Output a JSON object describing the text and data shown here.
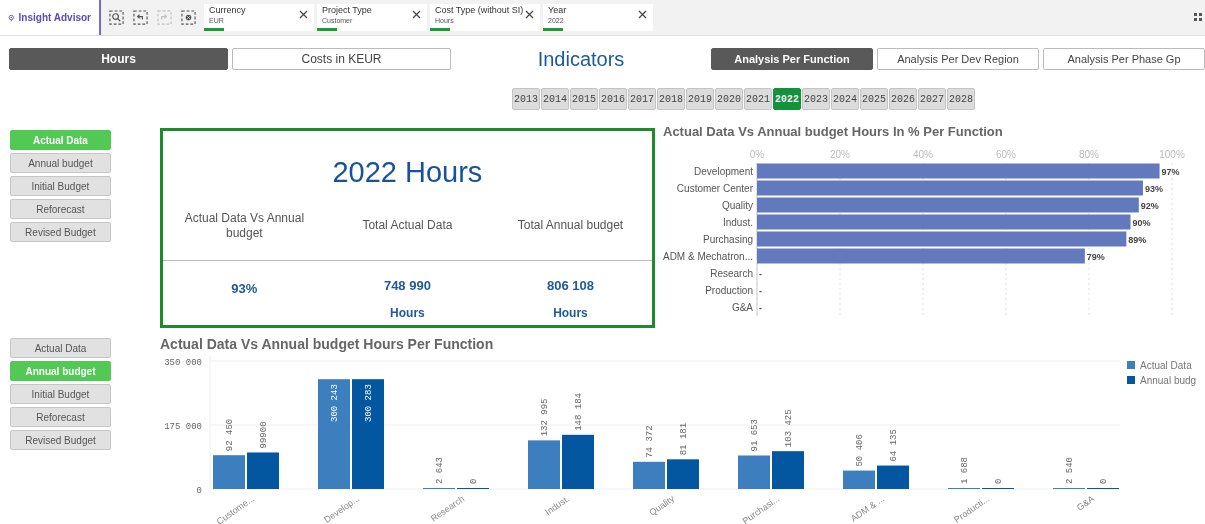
{
  "toolbar": {
    "advisor_label": "Insight Advisor",
    "tools": [
      {
        "kind": "search",
        "disabled": false
      },
      {
        "kind": "back",
        "disabled": false
      },
      {
        "kind": "forward",
        "disabled": true
      },
      {
        "kind": "clear",
        "disabled": false
      }
    ],
    "filters": [
      {
        "label": "Currency",
        "value": "EUR"
      },
      {
        "label": "Project Type",
        "value": "Customer"
      },
      {
        "label": "Cost Type (without SI)",
        "value": "Hours"
      },
      {
        "label": "Year",
        "value": "2022"
      }
    ]
  },
  "measure_tabs": [
    {
      "label": "Hours",
      "selected": true
    },
    {
      "label": "Costs in KEUR",
      "selected": false
    }
  ],
  "page_title": "Indicators",
  "analysis_tabs": [
    {
      "label": "Analysis Per Function",
      "selected": true
    },
    {
      "label": "Analysis Per Dev Region",
      "selected": false
    },
    {
      "label": "Analysis Per Phase Gp",
      "selected": false
    }
  ],
  "years": [
    {
      "label": "2013",
      "selected": false
    },
    {
      "label": "2014",
      "selected": false
    },
    {
      "label": "2015",
      "selected": false
    },
    {
      "label": "2016",
      "selected": false
    },
    {
      "label": "2017",
      "selected": false
    },
    {
      "label": "2018",
      "selected": false
    },
    {
      "label": "2019",
      "selected": false
    },
    {
      "label": "2020",
      "selected": false
    },
    {
      "label": "2021",
      "selected": false
    },
    {
      "label": "2022",
      "selected": true
    },
    {
      "label": "2023",
      "selected": false
    },
    {
      "label": "2024",
      "selected": false
    },
    {
      "label": "2025",
      "selected": false
    },
    {
      "label": "2026",
      "selected": false
    },
    {
      "label": "2027",
      "selected": false
    },
    {
      "label": "2028",
      "selected": false
    }
  ],
  "upper_versions": [
    {
      "label": "Actual Data",
      "selected": true
    },
    {
      "label": "Annual budget",
      "selected": false
    },
    {
      "label": "Initial Budget",
      "selected": false
    },
    {
      "label": "Reforecast",
      "selected": false
    },
    {
      "label": "Revised Budget",
      "selected": false
    }
  ],
  "kpi": {
    "title": "2022 Hours",
    "columns": [
      {
        "heading": "Actual Data Vs Annual budget",
        "value": "93%"
      },
      {
        "heading": "Total Actual Data",
        "value": "748 990",
        "unit": "Hours"
      },
      {
        "heading": "Total Annual budget",
        "value": "806 108",
        "unit": "Hours"
      }
    ]
  },
  "percent_chart": {
    "chart_data": {
      "type": "bar",
      "orientation": "horizontal",
      "title": "Actual Data Vs Annual budget Hours In % Per Function",
      "categories": [
        "Development",
        "Customer Center",
        "Quality",
        "Indust.",
        "Purchasing",
        "ADM & Mechatron...",
        "Research",
        "Production",
        "G&A"
      ],
      "series": [
        {
          "color": "#6379be",
          "values": [
            97,
            93,
            92,
            90,
            89,
            79,
            null,
            null,
            null
          ]
        }
      ],
      "grid": true,
      "xlim": [
        0,
        100
      ],
      "xticks": [
        {
          "value": 0,
          "label": "0%"
        },
        {
          "value": 20,
          "label": "20%"
        },
        {
          "value": 40,
          "label": "40%"
        },
        {
          "value": 60,
          "label": "60%"
        },
        {
          "value": 80,
          "label": "80%"
        },
        {
          "value": 100,
          "label": "100%"
        }
      ],
      "value_labels": [
        "97%",
        "93%",
        "92%",
        "90%",
        "89%",
        "79%",
        "-",
        "-",
        "-"
      ]
    }
  },
  "lower_versions": [
    {
      "label": "Actual Data",
      "selected": false
    },
    {
      "label": "Annual budget",
      "selected": true
    },
    {
      "label": "Initial Budget",
      "selected": false
    },
    {
      "label": "Reforecast",
      "selected": false
    },
    {
      "label": "Revised Budget",
      "selected": false
    }
  ],
  "column_chart": {
    "chart_data": {
      "type": "bar",
      "title": "Actual Data Vs Annual budget Hours Per Function",
      "categories": [
        "Custome...",
        "Develop...",
        "Research",
        "Indust.",
        "Quality",
        "Purchasi...",
        "ADM & ...",
        "Producti...",
        "G&A"
      ],
      "series": [
        {
          "name": "Actual Data",
          "color": "#3d7ebf",
          "values": [
            92450,
            300243,
            2643,
            132995,
            74372,
            91653,
            50406,
            1688,
            2540
          ]
        },
        {
          "name": "Annual budg",
          "color": "#0356a0",
          "values": [
            99900,
            300283,
            0,
            148184,
            81181,
            103425,
            64135,
            0,
            0
          ]
        }
      ],
      "ylim": [
        0,
        350000
      ],
      "grid": true,
      "legend": true,
      "yticks": [
        {
          "value": 0,
          "label": "0"
        },
        {
          "value": 175000,
          "label": "175 000"
        },
        {
          "value": 350000,
          "label": "350 000"
        }
      ],
      "value_labels": [
        [
          "92 450",
          "300 243",
          "2 643",
          "132 995",
          "74 372",
          "91 653",
          "50 406",
          "1 688",
          "2 540"
        ],
        [
          "99900",
          "300 283",
          "0",
          "148 184",
          "81 181",
          "103 425",
          "64 135",
          "0",
          "0"
        ]
      ]
    }
  }
}
